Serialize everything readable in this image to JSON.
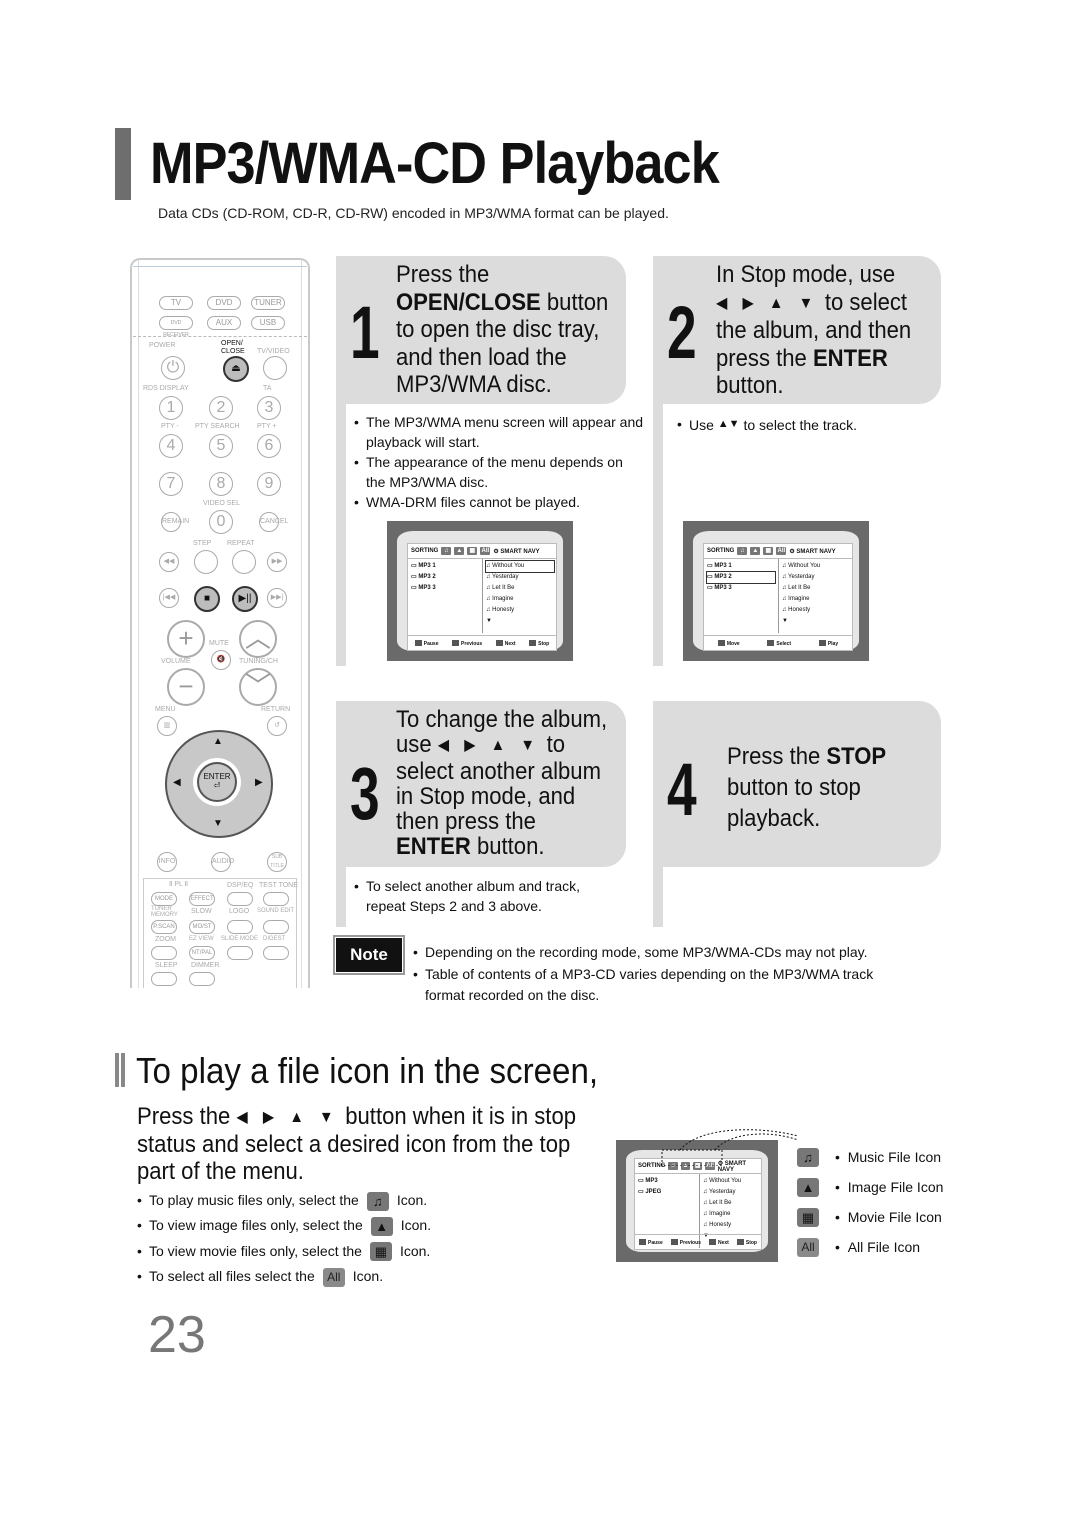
{
  "page": {
    "title": "MP3/WMA-CD Playback",
    "subtitle": "Data CDs (CD-ROM, CD-R, CD-RW) encoded in MP3/WMA format can be played.",
    "page_number": "23"
  },
  "remote": {
    "source_buttons": [
      "TV",
      "DVD",
      "TUNER",
      "DVD RECEIVER",
      "AUX",
      "USB"
    ],
    "labels": {
      "power": "POWER",
      "open_close": "OPEN/ CLOSE",
      "tv_video": "TV/VIDEO",
      "rds_display": "RDS DISPLAY",
      "ta": "TA",
      "pty_minus": "PTY -",
      "pty_search": "PTY SEARCH",
      "pty_plus": "PTY +",
      "video_sel": "VIDEO SEL",
      "step": "STEP",
      "repeat": "REPEAT",
      "mute": "MUTE",
      "volume": "VOLUME",
      "tuning_ch": "TUNING/CH",
      "menu": "MENU",
      "return": "RETURN",
      "enter": "ENTER",
      "pl2": "Ⅱ PL Ⅱ",
      "dsp_eq": "DSP/EQ",
      "test_tone": "TEST TONE",
      "tuner_memory": "TUNER MEMORY",
      "slow": "SLOW",
      "logo": "LOGO",
      "sound_edit": "SOUND EDIT",
      "zoom": "ZOOM",
      "ez_view": "EZ VIEW",
      "slide_mode": "SLIDE MODE",
      "digest": "DIGEST",
      "sleep": "SLEEP",
      "dimmer": "DIMMER"
    },
    "digits": [
      "1",
      "2",
      "3",
      "4",
      "5",
      "6",
      "7",
      "8",
      "9",
      "0"
    ],
    "small_buttons": {
      "remain": "REMAIN",
      "cancel": "CANCEL",
      "info": "INFO",
      "audio": "AUDIO",
      "subtitle": "SUB TITLE",
      "mode": "MODE",
      "effect": "EFFECT",
      "pscan": "P.SCAN",
      "most": "MO/ST",
      "ntpal": "NT/PAL"
    }
  },
  "steps": [
    {
      "number": "1",
      "lines": [
        "Press the",
        "OPEN/CLOSE|button",
        "to open the disc tray,",
        "and then load the",
        "MP3/WMA disc."
      ],
      "bullets": [
        "The MP3/WMA menu screen will appear and playback will start.",
        "The appearance of the menu depends on the MP3/WMA disc.",
        "WMA-DRM files cannot be played."
      ]
    },
    {
      "number": "2",
      "line1": "In Stop mode, use",
      "line2_suffix": "to select",
      "line3": "the album, and then",
      "line4_pre": "press the ",
      "line4_bold": "ENTER",
      "line5": "button.",
      "bullet_pre": "Use",
      "bullet_post": "to select the track."
    },
    {
      "number": "3",
      "line1": "To change the album,",
      "line2_pre": "use",
      "line2_post": "to",
      "line3": "select another album",
      "line4": "in Stop mode, and",
      "line5": "then press the",
      "line6_bold": "ENTER",
      "line6_post": " button.",
      "bullet": "To select another album and track, repeat Steps 2 and 3 above."
    },
    {
      "number": "4",
      "line1_pre": "Press the ",
      "line1_bold": "STOP",
      "line2": "button to stop",
      "line3": "playback."
    }
  ],
  "arrows": "◀ ▶ ▲ ▼",
  "arrows_ud": "▲▼",
  "osd": [
    {
      "sorting": "SORTING",
      "smart_navy": "⚙ SMART NAVY",
      "all": "All",
      "folders": [
        "MP3 1",
        "MP3 2",
        "MP3 3"
      ],
      "selected_folder": -1,
      "tracks": [
        "Without You",
        "Yesterday",
        "Let It Be",
        "Imagine",
        "Honesty"
      ],
      "selected_track": 0,
      "footer": [
        "Pause",
        "Previous",
        "Next",
        "Stop"
      ]
    },
    {
      "sorting": "SORTING",
      "smart_navy": "⚙ SMART NAVY",
      "all": "All",
      "folders": [
        "MP3 1",
        "MP3 2",
        "MP3 3"
      ],
      "selected_folder": 1,
      "tracks": [
        "Without You",
        "Yesterday",
        "Let It Be",
        "Imagine",
        "Honesty"
      ],
      "selected_track": -1,
      "footer": [
        "Move",
        "Select",
        "Play"
      ]
    },
    {
      "sorting": "SORTING",
      "smart_navy": "⚙ SMART NAVY",
      "all": "All",
      "folders": [
        "MP3",
        "JPEG"
      ],
      "selected_folder": -1,
      "tracks": [
        "Without You",
        "Yesterday",
        "Let It Be",
        "Imagine",
        "Honesty"
      ],
      "selected_track": -1,
      "footer": [
        "Pause",
        "Previous",
        "Next",
        "Stop"
      ]
    }
  ],
  "note": {
    "label": "Note",
    "bullets": [
      "Depending on the recording mode, some MP3/WMA-CDs may not play.",
      "Table of contents of a MP3-CD varies depending on the MP3/WMA track format recorded on the disc."
    ]
  },
  "section2": {
    "title": "To play a file icon in the screen,",
    "body_pre": "Press the",
    "body_post": "button when it is in stop",
    "body_line2": "status and select a desired icon from the top",
    "body_line3": "part of the menu.",
    "bullets": [
      {
        "pre": "To play music files only, select the",
        "icon": "music-icon",
        "glyph": "♫",
        "post": "Icon."
      },
      {
        "pre": "To view image files only, select the",
        "icon": "image-icon",
        "glyph": "▲",
        "post": "Icon."
      },
      {
        "pre": "To view movie files only, select the",
        "icon": "movie-icon",
        "glyph": "▦",
        "post": "Icon."
      },
      {
        "pre": "To select all files select the",
        "icon": "all-icon",
        "glyph": "All",
        "post": "Icon."
      }
    ],
    "legend": [
      {
        "icon": "music-icon",
        "glyph": "♫",
        "label": "Music File Icon"
      },
      {
        "icon": "image-icon",
        "glyph": "▲",
        "label": "Image File Icon"
      },
      {
        "icon": "movie-icon",
        "glyph": "▦",
        "label": "Movie File Icon"
      },
      {
        "icon": "all-icon",
        "glyph": "All",
        "label": "All File Icon"
      }
    ]
  }
}
